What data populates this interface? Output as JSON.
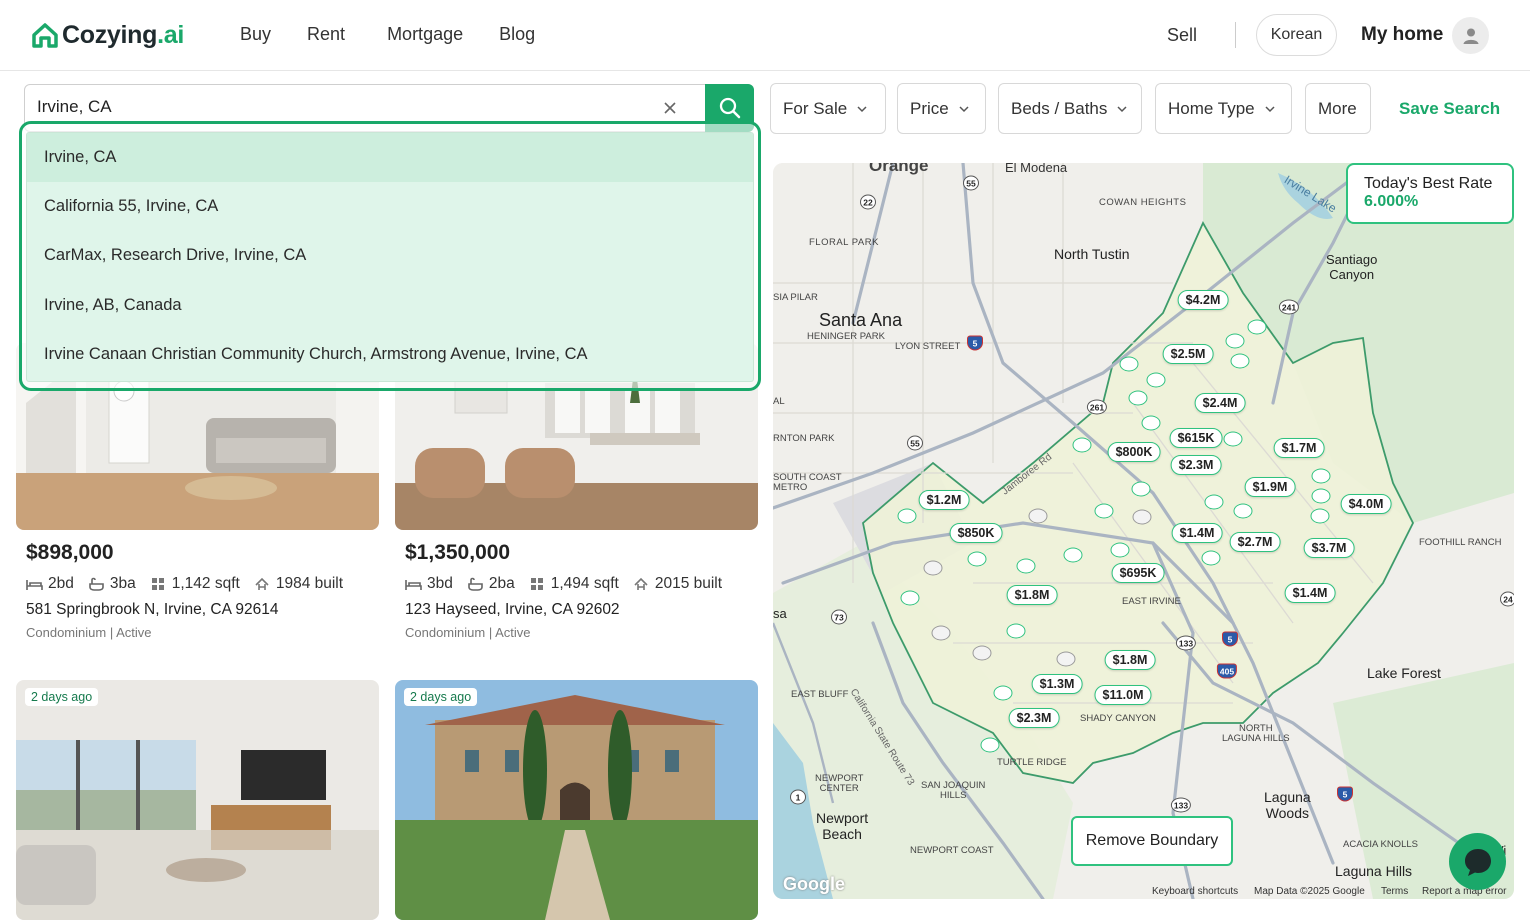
{
  "brand": {
    "name": "Cozying",
    "suffix": ".ai"
  },
  "nav": {
    "buy": "Buy",
    "rent": "Rent",
    "mortgage": "Mortgage",
    "blog": "Blog"
  },
  "header": {
    "sell": "Sell",
    "language": "Korean",
    "my_home": "My home"
  },
  "search": {
    "value": "Irvine, CA"
  },
  "filters": {
    "sale_type": "For Sale",
    "price": "Price",
    "beds_baths": "Beds / Baths",
    "home_type": "Home Type",
    "more": "More",
    "save_search": "Save Search"
  },
  "suggestions": [
    "Irvine, CA",
    "California 55, Irvine, CA",
    "CarMax, Research Drive, Irvine, CA",
    "Irvine, AB, Canada",
    "Irvine Canaan Christian Community Church, Armstrong Avenue, Irvine, CA"
  ],
  "listings": [
    {
      "price": "$898,000",
      "beds": "2bd",
      "baths": "3ba",
      "sqft": "1,142 sqft",
      "built": "1984 built",
      "address": "581 Springbrook N, Irvine, CA 92614",
      "meta": "Condominium | Active"
    },
    {
      "price": "$1,350,000",
      "beds": "3bd",
      "baths": "2ba",
      "sqft": "1,494 sqft",
      "built": "2015 built",
      "address": "123 Hayseed, Irvine, CA 92602",
      "meta": "Condominium | Active"
    },
    {
      "badge": "2 days ago"
    },
    {
      "badge": "2 days ago"
    }
  ],
  "map": {
    "rate_title": "Today's Best Rate",
    "rate_value": "6.000%",
    "remove_boundary": "Remove Boundary",
    "places": {
      "orange": "Orange",
      "el_modena": "El Modena",
      "cowan": "COWAN HEIGHTS",
      "irvine_lake": "Irvine Lake",
      "floral": "FLORAL PARK",
      "north_tustin": "North Tustin",
      "santiago1": "Santiago",
      "santiago2": "Canyon",
      "sia_pilar": "SIA PILAR",
      "santa_ana": "Santa Ana",
      "heninger": "HENINGER PARK",
      "lyon": "LYON STREET",
      "al": "AL",
      "anton": "RNTON PARK",
      "south_coast1": "SOUTH COAST",
      "south_coast2": "METRO",
      "jamboree": "Jamboree Rd",
      "foothill": "FOOTHILL RANCH",
      "east_irvine": "EAST IRVINE",
      "sa": "sa",
      "lake_forest": "Lake Forest",
      "east_bluff": "EAST BLUFF",
      "ca73": "California State Route 73",
      "shady": "SHADY CANYON",
      "north_lh1": "NORTH",
      "north_lh2": "LAGUNA HILLS",
      "turtle": "TURTLE RIDGE",
      "newport_c1": "NEWPORT",
      "newport_c2": "CENTER",
      "sjh1": "SAN JOAQUIN",
      "sjh2": "HILLS",
      "laguna_w1": "Laguna",
      "laguna_w2": "Woods",
      "newport_b1": "Newport",
      "newport_b2": "Beach",
      "newport_coast": "NEWPORT COAST",
      "acacia": "ACACIA KNOLLS",
      "laguna_hills": "Laguna Hills",
      "vi": "Vi"
    },
    "shields": [
      "55",
      "22",
      "241",
      "5",
      "261",
      "55",
      "73",
      "133",
      "5",
      "405",
      "1",
      "133",
      "5",
      "24"
    ],
    "price_pins": [
      {
        "label": "$4.2M"
      },
      {
        "label": "$2.5M"
      },
      {
        "label": "$2.4M"
      },
      {
        "label": "$615K"
      },
      {
        "label": "$800K"
      },
      {
        "label": "$2.3M"
      },
      {
        "label": "$1.7M"
      },
      {
        "label": "$1.9M"
      },
      {
        "label": "$4.0M"
      },
      {
        "label": "$1.2M"
      },
      {
        "label": "$850K"
      },
      {
        "label": "$1.4M"
      },
      {
        "label": "$2.7M"
      },
      {
        "label": "$3.7M"
      },
      {
        "label": "$695K"
      },
      {
        "label": "$1.8M"
      },
      {
        "label": "$1.4M"
      },
      {
        "label": "$1.8M"
      },
      {
        "label": "$1.3M"
      },
      {
        "label": "$11.0M"
      },
      {
        "label": "$2.3M"
      }
    ],
    "attribution": {
      "keyboard": "Keyboard shortcuts",
      "mapdata": "Map Data ©2025 Google",
      "terms": "Terms",
      "report": "Report a map error",
      "google": "Google"
    }
  }
}
